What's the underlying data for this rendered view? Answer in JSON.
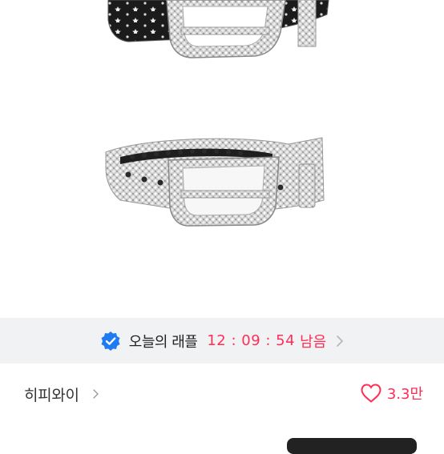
{
  "raffle": {
    "label": "오늘의 래플",
    "time": "12 : 09 : 54",
    "remaining": "남음"
  },
  "brand": {
    "name": "히피와이"
  },
  "likes": {
    "count": "3.3만"
  },
  "colors": {
    "accent": "#ff2e55",
    "verified": "#1e7bf2",
    "banner_bg": "#f1f2f4"
  },
  "icons": {
    "verified": "verified-badge-icon",
    "chevron": "chevron-right-icon",
    "heart": "heart-outline-icon"
  }
}
